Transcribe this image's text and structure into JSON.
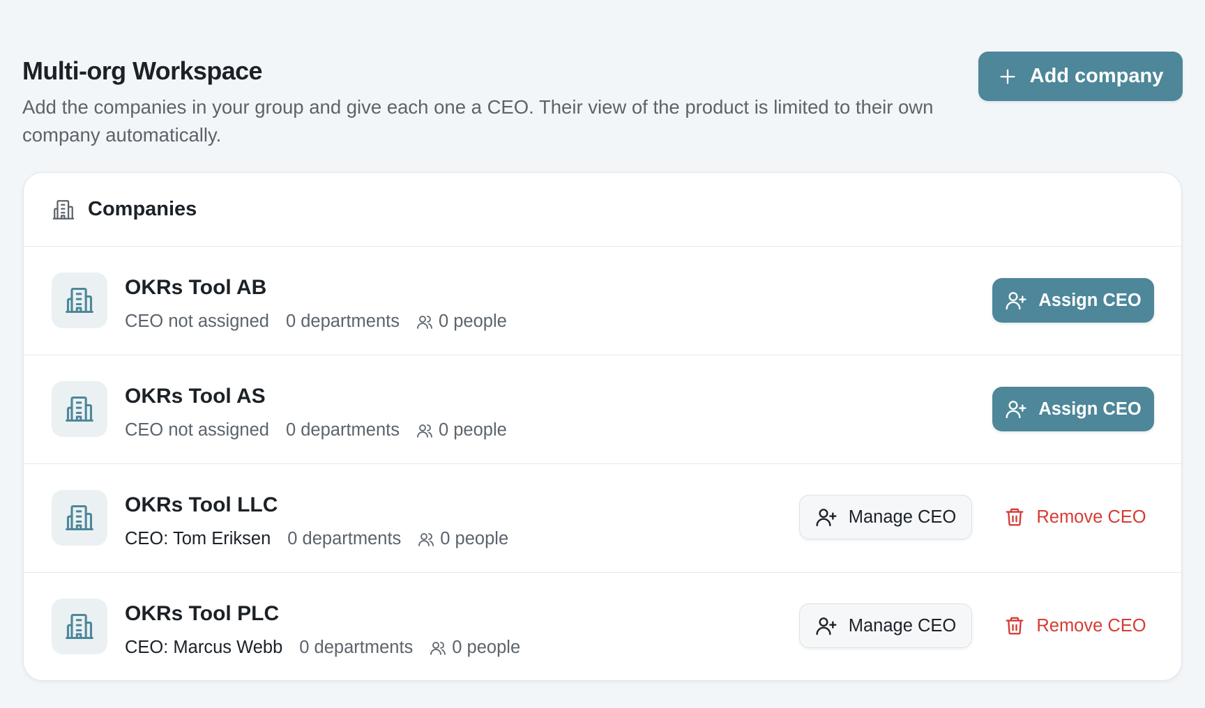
{
  "header": {
    "title": "Multi-org Workspace",
    "subtitle": "Add the companies in your group and give each one a CEO. Their view of the product is limited to their own company automatically.",
    "add_button_label": "Add company",
    "add_button_icon": "plus-icon"
  },
  "card": {
    "title": "Companies",
    "icon": "building-icon"
  },
  "companies": [
    {
      "name": "OKRs Tool AB",
      "ceo_status": "CEO not assigned",
      "departments": "0 departments",
      "people": "0 people",
      "assign_label": "Assign CEO"
    },
    {
      "name": "OKRs Tool AS",
      "ceo_status": "CEO not assigned",
      "departments": "0 departments",
      "people": "0 people",
      "assign_label": "Assign CEO"
    },
    {
      "name": "OKRs Tool LLC",
      "ceo_status": "CEO: Tom Eriksen",
      "departments": "0 departments",
      "people": "0 people",
      "manage_label": "Manage CEO",
      "remove_label": "Remove CEO"
    },
    {
      "name": "OKRs Tool PLC",
      "ceo_status": "CEO: Marcus Webb",
      "departments": "0 departments",
      "people": "0 people",
      "manage_label": "Manage CEO",
      "remove_label": "Remove CEO"
    }
  ],
  "colors": {
    "accent": "#4d8799",
    "danger": "#d63b33",
    "background": "#f3f6f8",
    "icon_tile": "#ebf1f3"
  }
}
